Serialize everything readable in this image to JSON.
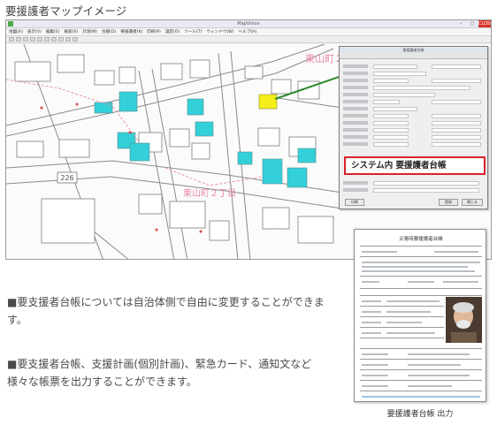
{
  "page_title": "要援護者マップイメージ",
  "app_window": {
    "title": "MapVision",
    "menu_items": [
      "地図(A)",
      "表示(V)",
      "編集(E)",
      "検索(S)",
      "計測(M)",
      "台帳(D)",
      "要援護者(K)",
      "印刷(P)",
      "設定(O)",
      "ツール(T)",
      "ウィンドウ(W)",
      "ヘルプ(H)"
    ],
    "close_label": "CLOSE"
  },
  "map": {
    "labels": {
      "town_a": "東山町２丁目",
      "town_b": "東山町２丁目",
      "route": "226"
    },
    "colors": {
      "highlight_cyan": "#33d0d9",
      "highlight_yellow": "#f6ee1a",
      "road_pink": "#e88aa2"
    }
  },
  "dialog": {
    "title": "要援護者台帳",
    "system_label": "システム内 要援護者台帳",
    "ok_button": "登録",
    "cancel_button": "閉じる",
    "print_button": "印刷"
  },
  "ledger": {
    "title": "災害時要援護者台帳",
    "caption": "要援護者台帳 出力"
  },
  "descriptions": [
    "■要支援者台帳については自治体側で自由に変更することができます。",
    "■要支援者台帳、支援計画(個別計画)、緊急カード、通知文など様々な帳票を出力することができます。"
  ]
}
